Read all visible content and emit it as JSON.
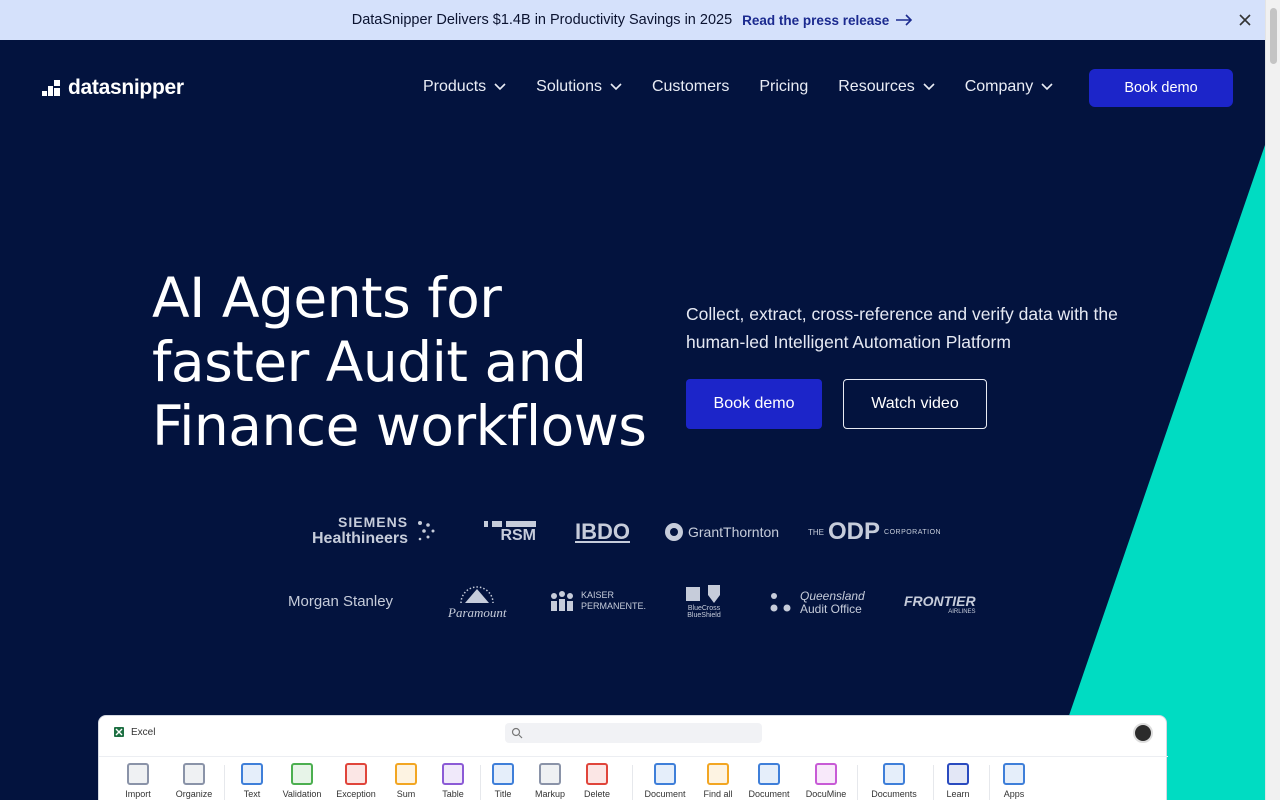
{
  "announcement": {
    "text": "DataSnipper Delivers $1.4B in Productivity Savings in 2025",
    "link": "Read the press release"
  },
  "brand": {
    "name": "datasnipper"
  },
  "nav": {
    "items": [
      {
        "label": "Products",
        "has_dropdown": true
      },
      {
        "label": "Solutions",
        "has_dropdown": true
      },
      {
        "label": "Customers",
        "has_dropdown": false
      },
      {
        "label": "Pricing",
        "has_dropdown": false
      },
      {
        "label": "Resources",
        "has_dropdown": true
      },
      {
        "label": "Company",
        "has_dropdown": true
      }
    ],
    "cta": "Book demo"
  },
  "hero": {
    "headline_lines": [
      "AI Agents for",
      "faster Audit and",
      "Finance workflows"
    ],
    "subtext": "Collect, extract, cross-reference and verify data with the human-led Intelligent Automation Platform",
    "primary_cta": "Book demo",
    "secondary_cta": "Watch video"
  },
  "logos": {
    "siemens_1": "SIEMENS",
    "siemens_2": "Healthineers",
    "rsm": "RSM",
    "bdo": "IBDO",
    "grant": "GrantThornton",
    "odp_the": "THE",
    "odp": "ODP",
    "odp_corp": "CORPORATION",
    "morgan": "Morgan Stanley",
    "paramount": "Paramount",
    "kaiser_1": "KAISER",
    "kaiser_2": "PERMANENTE.",
    "bcbs_1": "BlueCross",
    "bcbs_2": "BlueShield",
    "qao_1": "Queensland",
    "qao_2": "Audit Office",
    "frontier": "FRONTIER",
    "frontier_sub": "AIRLINES"
  },
  "app_preview": {
    "window_title": "Excel",
    "tools": [
      {
        "label": "Import",
        "color": "#8a93a8"
      },
      {
        "label": "Organize",
        "color": "#8a93a8"
      },
      {
        "label": "Text",
        "color": "#3f7fd9"
      },
      {
        "label": "Validation",
        "color": "#4caf50"
      },
      {
        "label": "Exception",
        "color": "#e0453b"
      },
      {
        "label": "Sum",
        "color": "#f2a623"
      },
      {
        "label": "Table",
        "color": "#8c5bd6"
      },
      {
        "label": "Title",
        "color": "#3f7fd9"
      },
      {
        "label": "Markup",
        "color": "#8a93a8"
      },
      {
        "label": "Delete",
        "color": "#e0453b"
      },
      {
        "label": "Document",
        "color": "#3f7fd9"
      },
      {
        "label": "Find all",
        "color": "#f2a623"
      },
      {
        "label": "Document",
        "color": "#3f7fd9"
      },
      {
        "label": "DocuMine",
        "color": "#c85bd6"
      },
      {
        "label": "Documents",
        "color": "#3f7fd9"
      },
      {
        "label": "Learn",
        "color": "#2a4bbf"
      },
      {
        "label": "Apps",
        "color": "#3f7fd9"
      }
    ]
  },
  "colors": {
    "background": "#03133e",
    "accent_teal": "#00dcc2",
    "primary_button": "#1c25c9",
    "announcement_bg": "#d5e1fb"
  }
}
